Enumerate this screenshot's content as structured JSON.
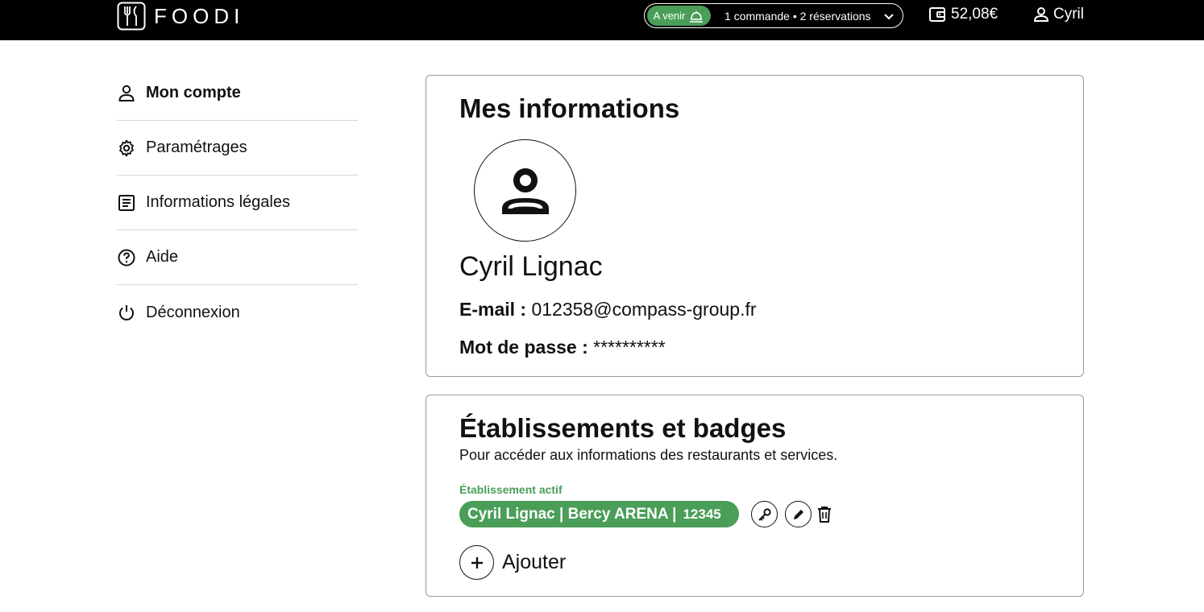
{
  "header": {
    "logo_text": "FOODI",
    "upcoming_label": "A venir",
    "upcoming_summary": "1 commande • 2 réservations",
    "wallet_balance": "52,08€",
    "user_name": "Cyril",
    "colors": {
      "background": "#000000",
      "accent": "#4a9e58"
    }
  },
  "sidebar": {
    "items": [
      {
        "label": "Mon compte",
        "icon": "person-icon",
        "active": true
      },
      {
        "label": "Paramétrages",
        "icon": "gear-icon"
      },
      {
        "label": "Informations légales",
        "icon": "document-icon"
      },
      {
        "label": "Aide",
        "icon": "help-icon"
      },
      {
        "label": "Déconnexion",
        "icon": "power-icon"
      }
    ]
  },
  "profile": {
    "title": "Mes informations",
    "full_name": "Cyril Lignac",
    "email_label": "E-mail :",
    "email_value": "012358@compass-group.fr",
    "password_label": "Mot de passe :",
    "password_value": "**********"
  },
  "establishments": {
    "title": "Établissements et badges",
    "subtitle": "Pour accéder aux informations des restaurants et services.",
    "active_label": "Établissement actif",
    "active_name": "Cyril Lignac | Bercy ARENA |",
    "active_code": "12345",
    "add_label": "Ajouter"
  }
}
